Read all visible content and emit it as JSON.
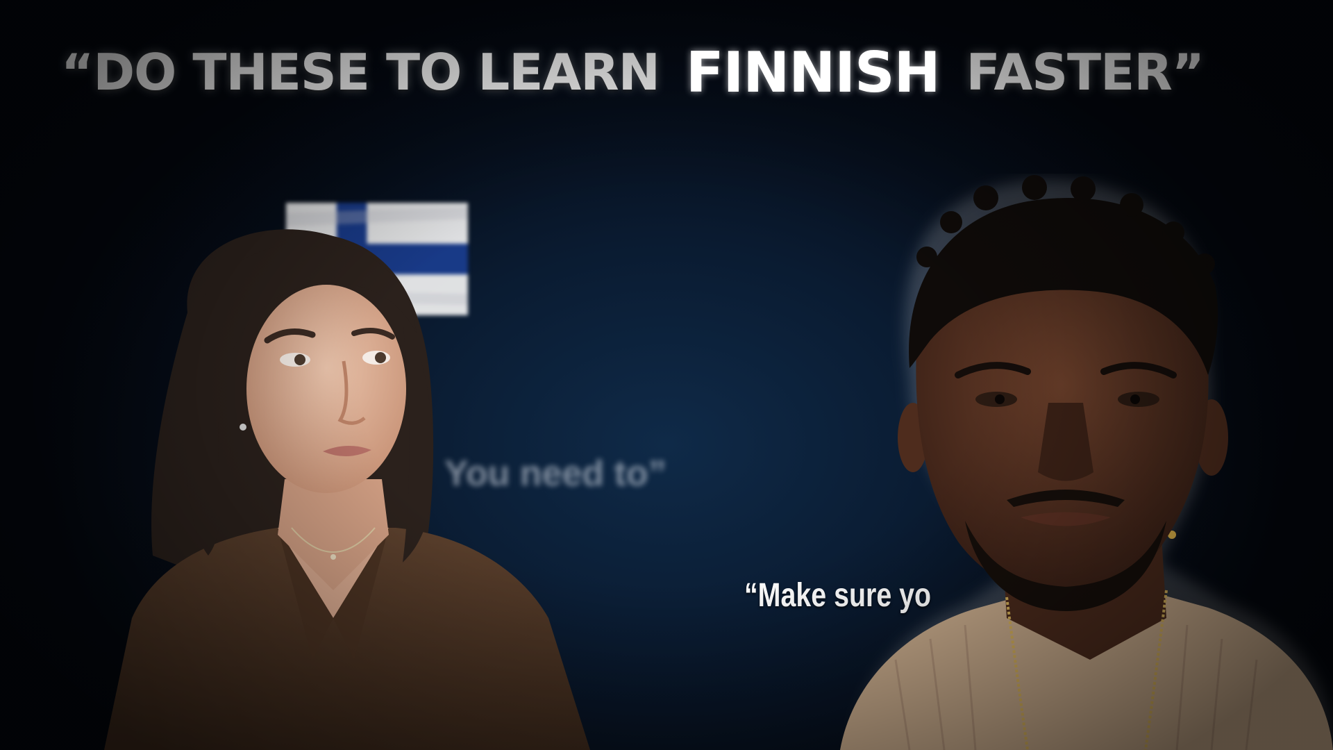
{
  "headline": {
    "before": "“DO THESE TO LEARN",
    "highlight": "FINNISH",
    "after": "FASTER”",
    "highlight_color": "#e0141b",
    "text_color": "#ffffff"
  },
  "background": {
    "blurred_caption": "You need to”",
    "flag_icon": "finland-flag-icon"
  },
  "caption_right": "“Make sure yo",
  "colors": {
    "background_dark": "#050b15",
    "background_glow": "#0f2a48",
    "accent_red": "#e0141b"
  }
}
